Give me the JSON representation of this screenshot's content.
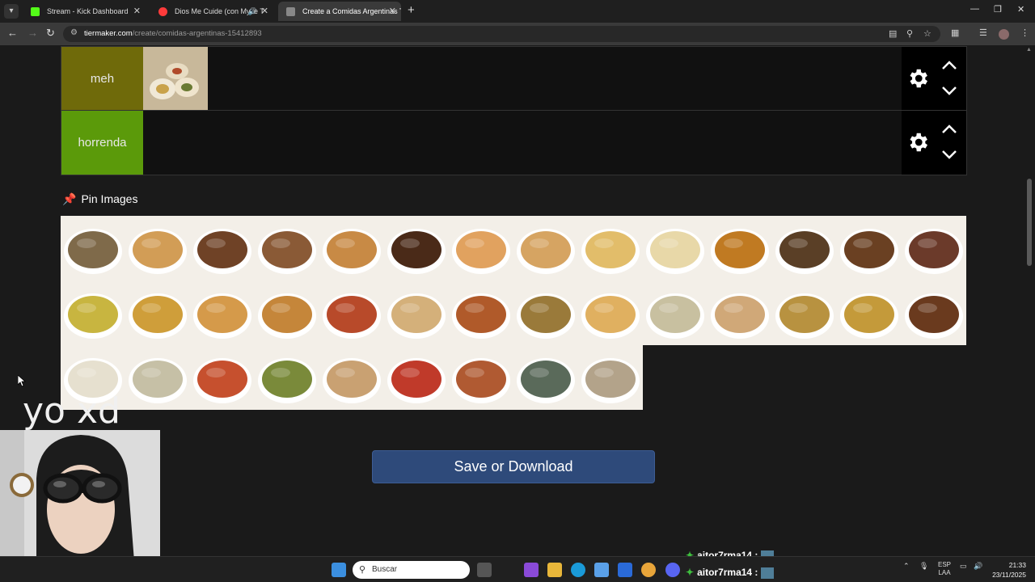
{
  "tabs": [
    {
      "title": "Stream - Kick Dashboard",
      "favicon_color": "#53fc18"
    },
    {
      "title": "Dios Me Cuide (con Myke T",
      "favicon_color": "#ff3b3b"
    },
    {
      "title": "Create a Comidas Argentinas Ti",
      "favicon_color": "#888888"
    }
  ],
  "url": {
    "host": "tiermaker.com",
    "path": "/create/comidas-argentinas-15412893"
  },
  "tiers": [
    {
      "label": "meh",
      "color": "#6f6a0a"
    },
    {
      "label": "horrenda",
      "color": "#5b9a0a"
    }
  ],
  "pin_images_label": "Pin Images",
  "save_label": "Save or Download",
  "overlay_text": "yo xd",
  "chat": [
    {
      "user": "aitor7rma14 :"
    },
    {
      "user": "aitor7rma14 :"
    }
  ],
  "taskbar": {
    "search_placeholder": "Buscar",
    "lang_top": "ESP",
    "lang_bottom": "LAA",
    "time": "21:33",
    "date": "23/11/2025"
  },
  "food_colors": [
    "#7f6a4a",
    "#d29d56",
    "#6f4226",
    "#8a5a36",
    "#c88a45",
    "#4a2a18",
    "#e1a25f",
    "#d6a462",
    "#e2bd6a",
    "#e8d8a8",
    "#c07a22",
    "#5a3f26",
    "#6a4022",
    "#6b3a2a",
    "#c8b540",
    "#cf9e3a",
    "#d59a4a",
    "#c5863a",
    "#b84a2a",
    "#d4b07a",
    "#b05a2a",
    "#9a7a3a",
    "#e0b060",
    "#c8c0a0",
    "#d0a878",
    "#b89240",
    "#c49a3a",
    "#6a3a1e",
    "#e6e0cf",
    "#c6c0a6",
    "#c6502e",
    "#7a8a3a",
    "#c9a172",
    "#c03a2a",
    "#b05a32",
    "#5a6a5a",
    "#b3a38a"
  ]
}
